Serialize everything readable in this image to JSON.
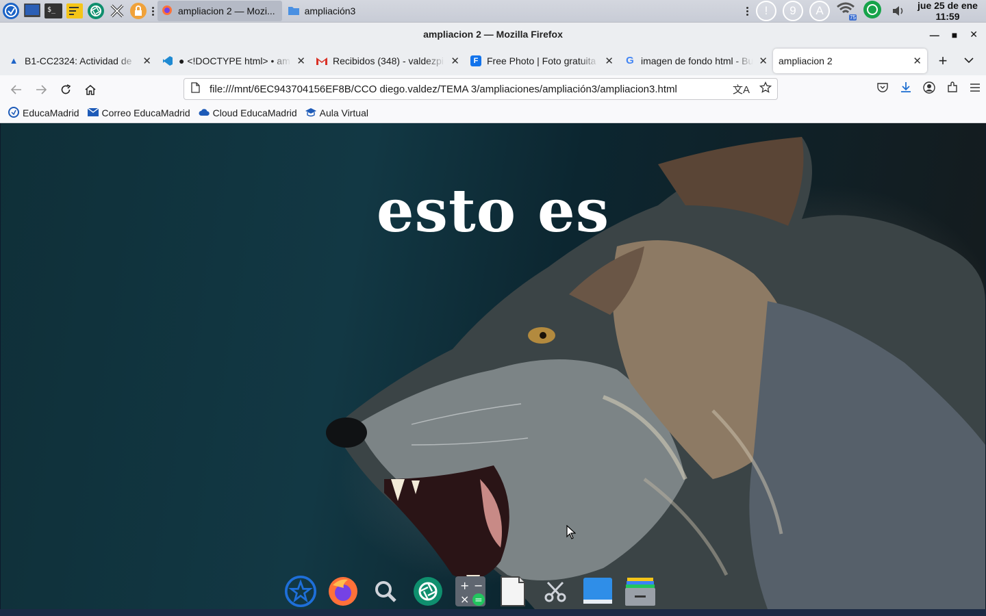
{
  "desktop_panel": {
    "tasks": [
      {
        "label": "ampliacion 2 — Mozi...",
        "icon": "firefox-icon",
        "active": true
      },
      {
        "label": "ampliación3",
        "icon": "folder-icon",
        "active": false
      }
    ],
    "clock": {
      "date": "jue 25 de ene",
      "time": "11:59"
    },
    "tray": {
      "update_badge": "9",
      "account_badge": "A",
      "network_signal": "75"
    }
  },
  "window": {
    "title": "ampliacion 2 — Mozilla Firefox"
  },
  "tabs": [
    {
      "label": "B1-CC2324: Actividad de",
      "icon": "moodle-icon",
      "active": false
    },
    {
      "label": "● <!DOCTYPE html> • am",
      "icon": "vscode-icon",
      "active": false
    },
    {
      "label": "Recibidos (348) - valdezpi",
      "icon": "gmail-icon",
      "active": false
    },
    {
      "label": "Free Photo | Foto gratuita",
      "icon": "freepik-icon",
      "active": false
    },
    {
      "label": "imagen de fondo html - Bu",
      "icon": "google-icon",
      "active": false
    },
    {
      "label": "ampliacion 2",
      "icon": "none",
      "active": true
    }
  ],
  "navbar": {
    "url": "file:///mnt/6EC943704156EF8B/CCO diego.valdez/TEMA 3/ampliaciones/ampliación3/ampliacion3.html"
  },
  "bookmarks": [
    {
      "label": "EducaMadrid",
      "icon": "educamadrid-icon"
    },
    {
      "label": "Correo EducaMadrid",
      "icon": "mail-icon"
    },
    {
      "label": "Cloud EducaMadrid",
      "icon": "cloud-icon"
    },
    {
      "label": "Aula Virtual",
      "icon": "aula-virtual-icon"
    }
  ],
  "page": {
    "heading": "esto es"
  },
  "dock": [
    "launcher-icon",
    "firefox-icon",
    "search-icon",
    "screenshot-icon",
    "calculator-icon",
    "text-editor-icon",
    "scissors-icon",
    "display-icon",
    "file-manager-icon"
  ]
}
